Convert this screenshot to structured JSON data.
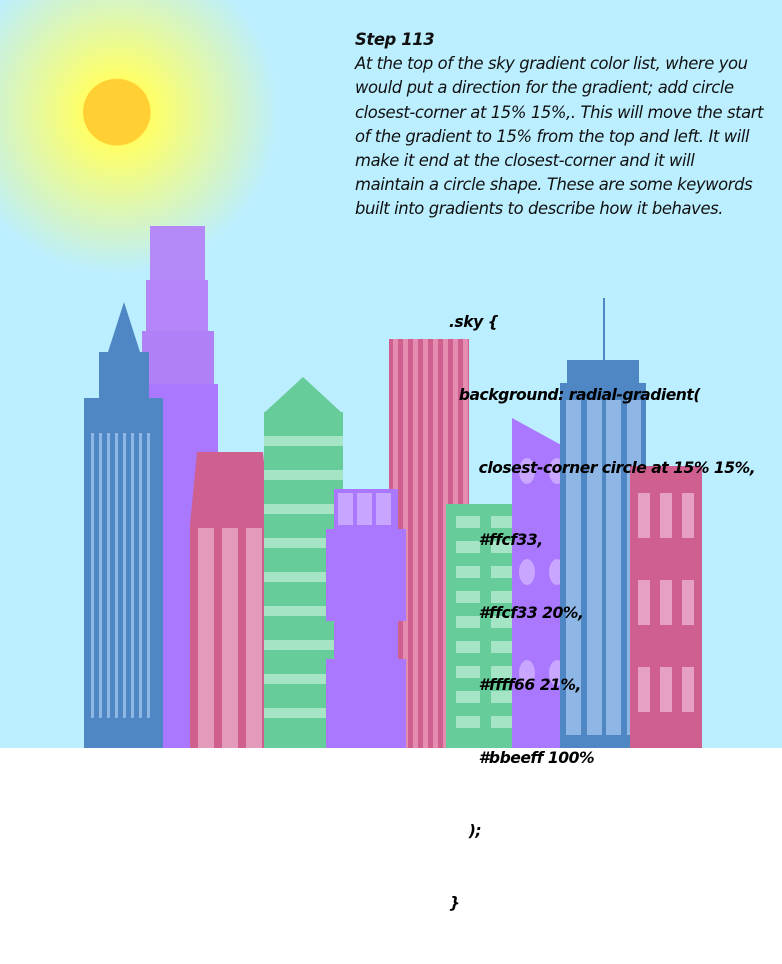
{
  "step": {
    "title": "Step 113",
    "body": "At the top of the sky gradient color list, where you would put a direction for the gradient; add circle closest-corner at 15% 15%,. This will move the start of the gradient to 15% from the top and left. It will make it end at the closest-corner and it will maintain a circle shape. These are some keywords built into gradients to describe how it behaves."
  },
  "code": {
    "lines": [
      ".sky {",
      "  background: radial-gradient(",
      "      closest-corner circle at 15% 15%,",
      "      #ffcf33,",
      "      #ffcf33 20%,",
      "      #ffff66 21%,",
      "      #bbeeff 100%",
      "    );",
      "}"
    ]
  },
  "colors": {
    "sky_inner": "#ffcf33",
    "sky_ring": "#ffff66",
    "sky_outer": "#bbeeff",
    "building_blue": "#4f87c4",
    "building_purple": "#aa77ff",
    "building_pink": "#cf5f8f",
    "building_green": "#66cc99"
  }
}
